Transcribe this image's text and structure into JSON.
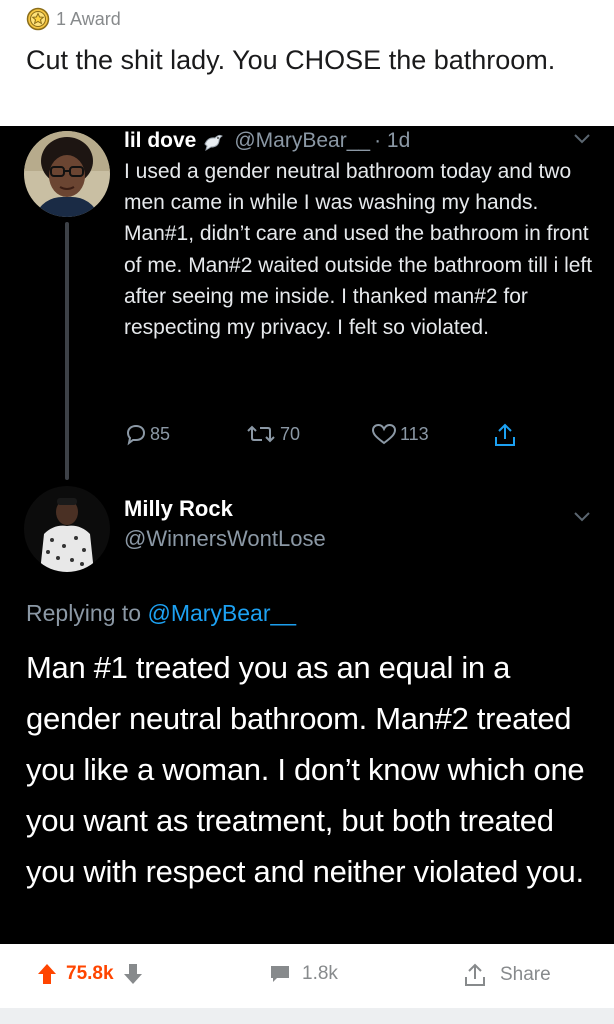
{
  "award": {
    "label": "1 Award",
    "icon": "award-badge-icon"
  },
  "post": {
    "title": "Cut the shit lady. You CHOSE the bathroom."
  },
  "tweet1": {
    "name": "lil dove",
    "handle": "@MaryBear__",
    "time": "· 1d",
    "text": "I used a gender neutral bathroom today and two men came in while I was washing my hands. Man#1, didn’t care and used the bathroom in front of me. Man#2 waited outside the bathroom till i left after seeing me inside. I thanked man#2 for respecting my privacy. I felt so violated.",
    "replies": "85",
    "retweets": "70",
    "likes": "113"
  },
  "tweet2": {
    "name": "Milly Rock",
    "handle": "@WinnersWontLose",
    "replying_prefix": "Replying to ",
    "replying_to": "@MaryBear__",
    "text": "Man #1 treated you as an equal in a gender neutral bathroom. Man#2 treated you like a woman. I don’t know which one you want as treatment, but both treated you with respect and neither violated you."
  },
  "footer": {
    "votes": "75.8k",
    "comments": "1.8k",
    "share_label": "Share"
  },
  "colors": {
    "upvote": "#ff4500",
    "tweet_bg": "#000000",
    "link_blue": "#1da1f2",
    "muted": "#8b98a5"
  }
}
